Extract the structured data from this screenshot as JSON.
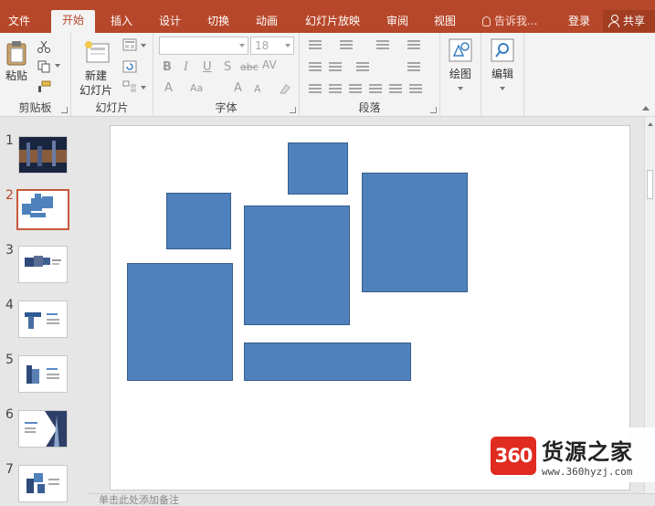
{
  "tabs": [
    {
      "label": "文件",
      "active": false
    },
    {
      "label": "开始",
      "active": true
    },
    {
      "label": "插入",
      "active": false
    },
    {
      "label": "设计",
      "active": false
    },
    {
      "label": "切换",
      "active": false
    },
    {
      "label": "动画",
      "active": false
    },
    {
      "label": "幻灯片放映",
      "active": false
    },
    {
      "label": "审阅",
      "active": false
    },
    {
      "label": "视图",
      "active": false
    }
  ],
  "tell_me": "告诉我...",
  "login": "登录",
  "share": "共享",
  "ribbon": {
    "clipboard": {
      "label": "剪贴板",
      "paste": "粘贴"
    },
    "slides": {
      "label": "幻灯片",
      "new_slide_line1": "新建",
      "new_slide_line2": "幻灯片"
    },
    "font": {
      "label": "字体",
      "font_name": "",
      "font_size": "18"
    },
    "paragraph": {
      "label": "段落"
    },
    "drawing": {
      "label": "绘图"
    },
    "editing": {
      "label": "编辑"
    }
  },
  "slides": [
    {
      "number": "1",
      "selected": false
    },
    {
      "number": "2",
      "selected": true
    },
    {
      "number": "3",
      "selected": false
    },
    {
      "number": "4",
      "selected": false
    },
    {
      "number": "5",
      "selected": false
    },
    {
      "number": "6",
      "selected": false
    },
    {
      "number": "7",
      "selected": false
    }
  ],
  "notes_hint": "单击此处添加备注",
  "colors": {
    "accent": "#b7472a",
    "shape_fill": "#4f81bd",
    "shape_border": "#385d8a"
  },
  "watermark": {
    "logo": "360",
    "title": "货源之家",
    "url": "www.360hyzj.com"
  }
}
